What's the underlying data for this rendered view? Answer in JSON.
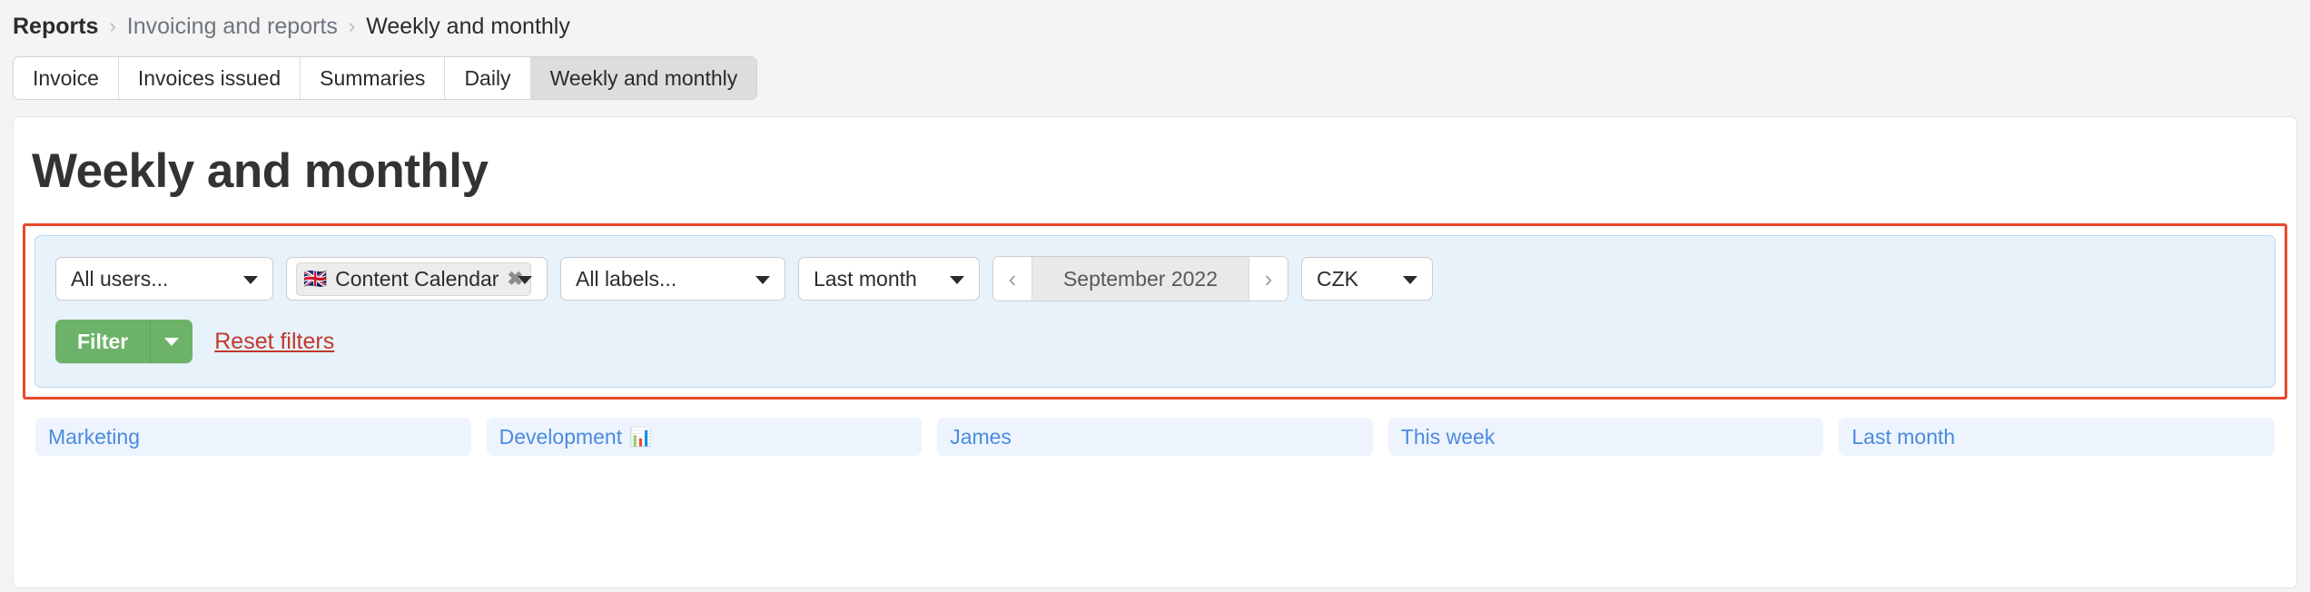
{
  "breadcrumb": {
    "items": [
      {
        "label": "Reports",
        "style": "strong"
      },
      {
        "label": "Invoicing and reports",
        "style": "muted"
      },
      {
        "label": "Weekly and monthly",
        "style": "current"
      }
    ],
    "separator": "›"
  },
  "tabs": [
    {
      "label": "Invoice",
      "active": false
    },
    {
      "label": "Invoices issued",
      "active": false
    },
    {
      "label": "Summaries",
      "active": false
    },
    {
      "label": "Daily",
      "active": false
    },
    {
      "label": "Weekly and monthly",
      "active": true
    }
  ],
  "page": {
    "title": "Weekly and monthly"
  },
  "filters": {
    "users_select": "All users...",
    "tags_select": {
      "tag_flag": "🇬🇧",
      "tag_label": "Content Calendar",
      "tag_remove": "✖"
    },
    "labels_select": "All labels...",
    "period_select": "Last month",
    "date_stepper": {
      "prev": "‹",
      "value": "September 2022",
      "next": "›"
    },
    "currency_select": "CZK",
    "filter_button": "Filter",
    "reset_link": "Reset filters"
  },
  "chips": [
    {
      "label": "Marketing",
      "emoji": ""
    },
    {
      "label": "Development",
      "emoji": "📊"
    },
    {
      "label": "James",
      "emoji": ""
    },
    {
      "label": "This week",
      "emoji": ""
    },
    {
      "label": "Last month",
      "emoji": ""
    }
  ],
  "colors": {
    "accent_green": "#6cb269",
    "reset_red": "#c0392b",
    "highlight_red": "#e8472a",
    "panel_blue_bg": "#e8f2fb",
    "panel_blue_border": "#b9d7ef",
    "chip_blue_text": "#4a8bdf",
    "chip_blue_bg": "#eef4fd"
  }
}
